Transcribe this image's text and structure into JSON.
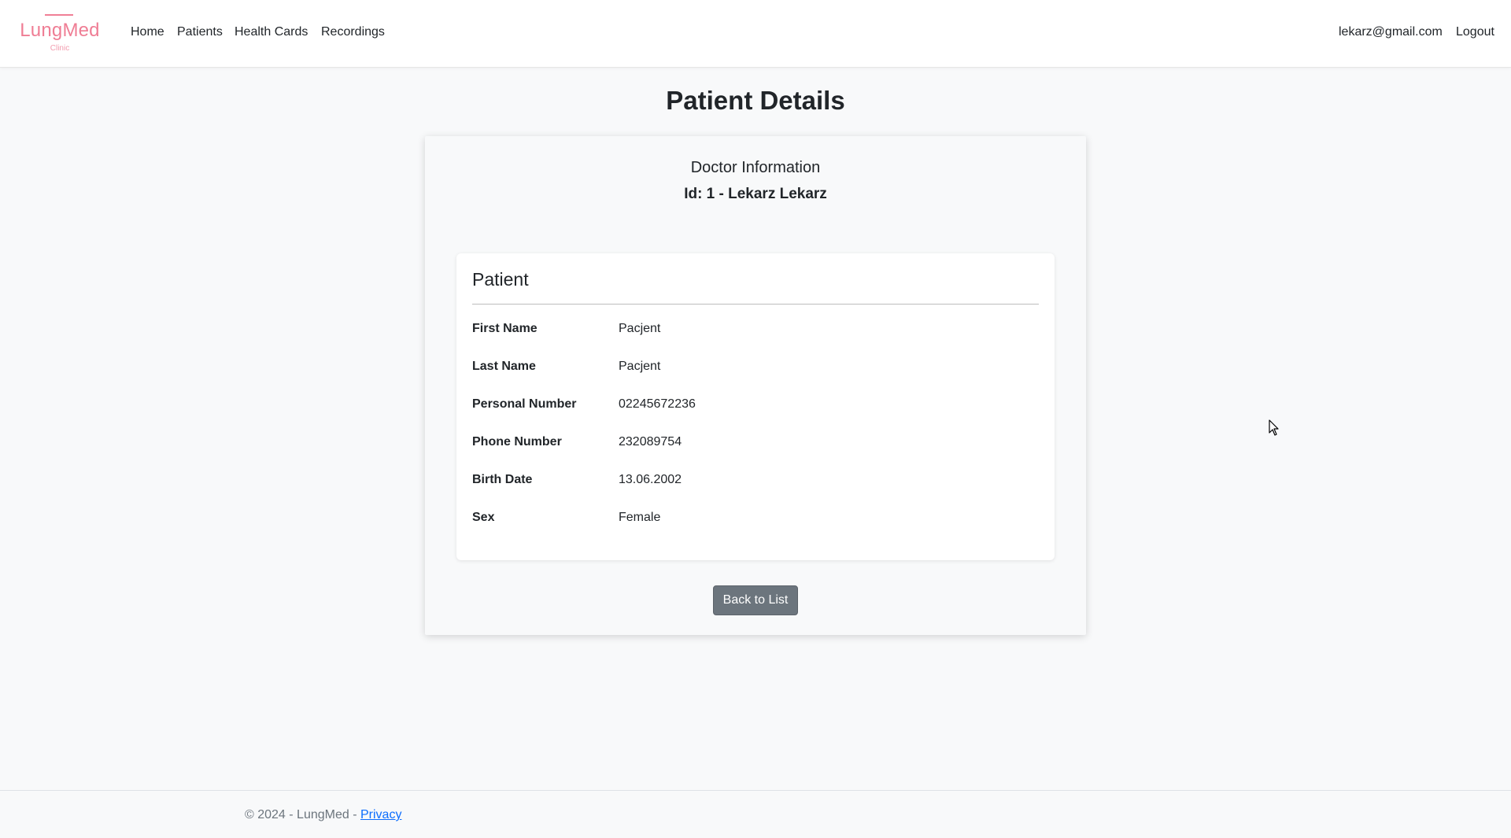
{
  "brand": {
    "name": "LungMed",
    "subtitle": "Clinic",
    "color": "#ef7d94"
  },
  "nav": {
    "items": [
      {
        "label": "Home"
      },
      {
        "label": "Patients"
      },
      {
        "label": "Health Cards"
      },
      {
        "label": "Recordings"
      }
    ],
    "user_email": "lekarz@gmail.com",
    "logout_label": "Logout"
  },
  "page": {
    "title": "Patient Details"
  },
  "doctor": {
    "heading": "Doctor Information",
    "id_line": "Id: 1 - Lekarz Lekarz"
  },
  "patient": {
    "title": "Patient",
    "fields": [
      {
        "label": "First Name",
        "value": "Pacjent"
      },
      {
        "label": "Last Name",
        "value": "Pacjent"
      },
      {
        "label": "Personal Number",
        "value": "02245672236"
      },
      {
        "label": "Phone Number",
        "value": "232089754"
      },
      {
        "label": "Birth Date",
        "value": "13.06.2002"
      },
      {
        "label": "Sex",
        "value": "Female"
      }
    ]
  },
  "actions": {
    "back_label": "Back to List",
    "back_color": "#6c757d"
  },
  "footer": {
    "text": "© 2024 - LungMed - ",
    "privacy_label": "Privacy"
  }
}
